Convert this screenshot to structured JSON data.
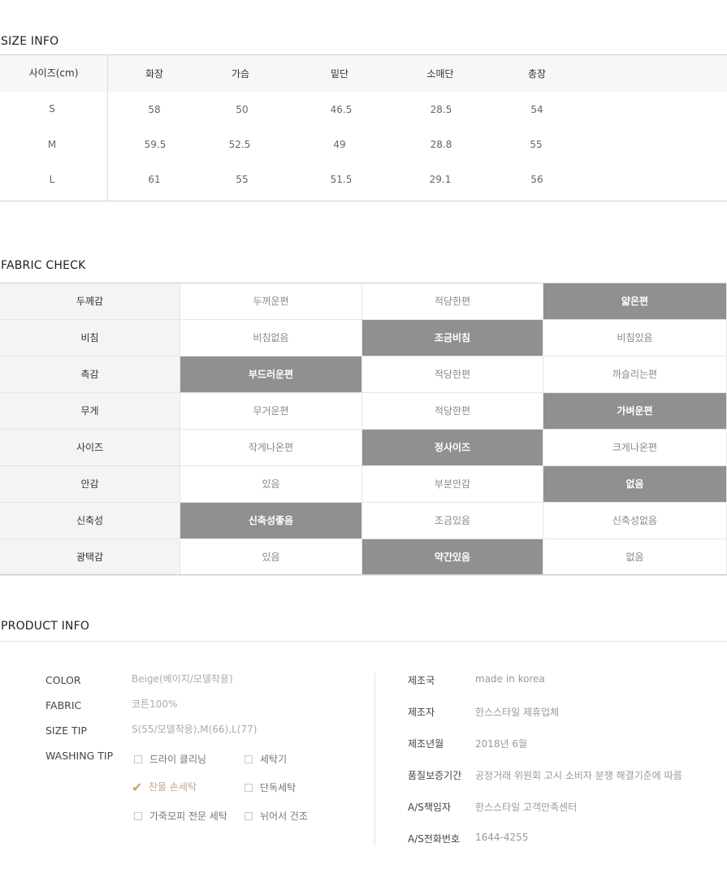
{
  "size_info": {
    "title": "SIZE INFO",
    "headers": [
      "사이즈(cm)",
      "화장",
      "가슴",
      "밑단",
      "소매단",
      "총장"
    ],
    "rows": [
      [
        "S",
        "58",
        "50",
        "46.5",
        "28.5",
        "54"
      ],
      [
        "M",
        "59.5",
        "52.5",
        "49",
        "28.8",
        "55"
      ],
      [
        "L",
        "61",
        "55",
        "51.5",
        "29.1",
        "56"
      ]
    ]
  },
  "fabric_check": {
    "title": "FABRIC CHECK",
    "rows": [
      {
        "label": "두께감",
        "options": [
          "두꺼운편",
          "적당한편",
          "얇은편"
        ],
        "selected": 2
      },
      {
        "label": "비침",
        "options": [
          "비침없음",
          "조금비침",
          "비침있음"
        ],
        "selected": 1
      },
      {
        "label": "촉감",
        "options": [
          "부드러운편",
          "적당한편",
          "까슬리는편"
        ],
        "selected": 0
      },
      {
        "label": "무게",
        "options": [
          "무거운편",
          "적당한편",
          "가벼운편"
        ],
        "selected": 2
      },
      {
        "label": "사이즈",
        "options": [
          "작게나온편",
          "정사이즈",
          "크게나온편"
        ],
        "selected": 1
      },
      {
        "label": "안감",
        "options": [
          "있음",
          "부분안감",
          "없음"
        ],
        "selected": 2
      },
      {
        "label": "신축성",
        "options": [
          "신축성좋음",
          "조금있음",
          "신축성없음"
        ],
        "selected": 0
      },
      {
        "label": "광택감",
        "options": [
          "있음",
          "약간있음",
          "없음"
        ],
        "selected": 1
      }
    ]
  },
  "product_info": {
    "title": "PRODUCT INFO",
    "left": {
      "color_label": "COLOR",
      "color_value": "Beige(베이지/모델착용)",
      "fabric_label": "FABRIC",
      "fabric_value": "코튼100%",
      "size_tip_label": "SIZE TIP",
      "size_tip_value": "S(55/모델착용),M(66),L(77)",
      "washing_tip_label": "WASHING TIP",
      "washing_options": [
        {
          "label": "드라이 클리닝",
          "checked": false
        },
        {
          "label": "세탁기",
          "checked": false
        },
        {
          "label": "찬물 손세탁",
          "checked": true
        },
        {
          "label": "단독세탁",
          "checked": false
        },
        {
          "label": "가죽모피 전문 세탁",
          "checked": false
        },
        {
          "label": "뉘어서 건조",
          "checked": false
        }
      ]
    },
    "right": [
      {
        "label": "제조국",
        "value": "made in korea"
      },
      {
        "label": "제조자",
        "value": "한스스타일 제휴업체"
      },
      {
        "label": "제조년월",
        "value": "2018년 6월"
      },
      {
        "label": "품질보증기간",
        "value": "공정거래 위원회 고시 소비자 분쟁 해결기준에 따름"
      },
      {
        "label": "A/S책임자",
        "value": "한스스타일 고객만족센터"
      },
      {
        "label": "A/S전화번호",
        "value": "1644-4255"
      }
    ]
  },
  "colors": {
    "selected_bg": "#909090",
    "label_bg": "#f4f4f4",
    "checked_accent": "#c8a883"
  }
}
